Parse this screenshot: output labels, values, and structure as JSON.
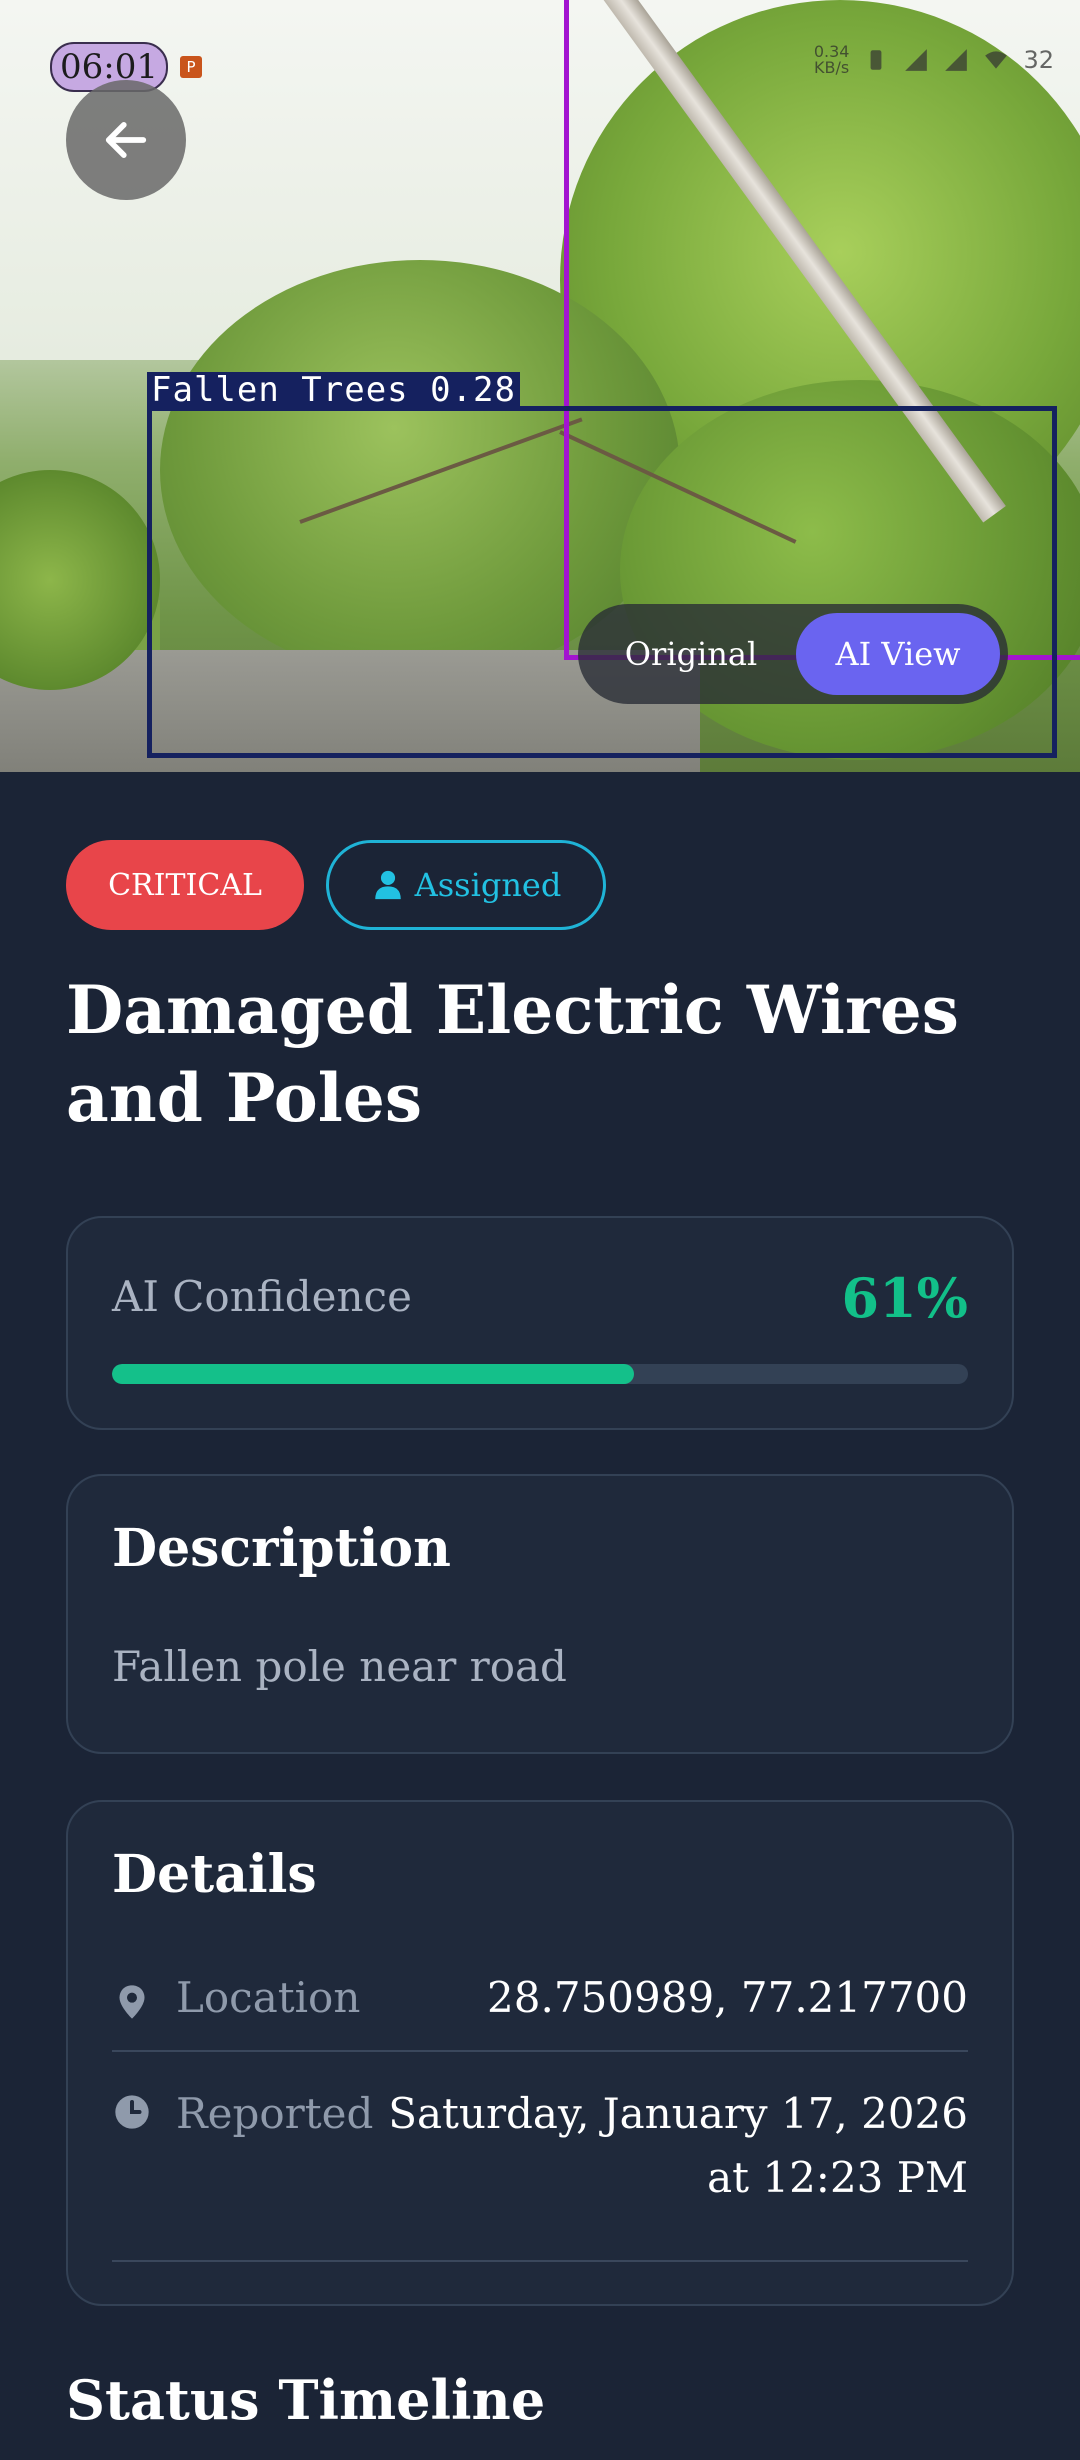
{
  "status_bar": {
    "time": "06:01",
    "notification_badge": "P",
    "data_speed": "0.34",
    "data_unit": "KB/s",
    "battery": "32"
  },
  "hero": {
    "detection_label": "Fallen Trees 0.28",
    "toggle": {
      "original_label": "Original",
      "ai_view_label": "AI View",
      "selected": "AI View"
    }
  },
  "badges": {
    "severity": "CRITICAL",
    "status": "Assigned"
  },
  "title": "Damaged Electric Wires and Poles",
  "confidence": {
    "label": "AI Confidence",
    "value_text": "61%",
    "value": 0.61
  },
  "description": {
    "heading": "Description",
    "text": "Fallen pole near road"
  },
  "details": {
    "heading": "Details",
    "location_label": "Location",
    "location_value": "28.750989, 77.217700",
    "reported_label": "Reported",
    "reported_value_line1": "Saturday, January 17, 2026",
    "reported_value_line2": "at 12:23 PM"
  },
  "timeline": {
    "heading": "Status Timeline"
  },
  "colors": {
    "background": "#1b2436",
    "card": "#1f293b",
    "critical": "#e8454a",
    "assigned": "#22c1e2",
    "confidence": "#14c08a",
    "toggle_active": "#6a64f0"
  }
}
